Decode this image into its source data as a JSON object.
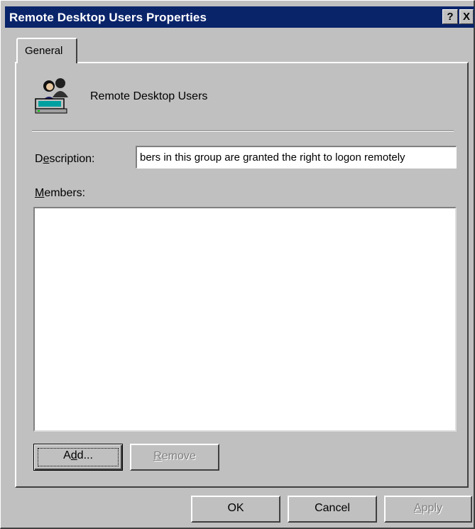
{
  "window": {
    "title": "Remote Desktop Users Properties",
    "help_glyph": "?",
    "close_glyph": "X"
  },
  "tabs": [
    {
      "label": "General"
    }
  ],
  "group": {
    "icon": "users-group-icon",
    "name": "Remote Desktop Users"
  },
  "description": {
    "label_pre": "D",
    "label_ul": "e",
    "label_post": "scription:",
    "value": "bers in this group are granted the right to logon remotely"
  },
  "members": {
    "label_pre": "",
    "label_ul": "M",
    "label_post": "embers:",
    "items": []
  },
  "buttons": {
    "add_pre": "A",
    "add_ul": "d",
    "add_post": "d...",
    "remove_pre": "",
    "remove_ul": "R",
    "remove_post": "emove",
    "ok": "OK",
    "cancel": "Cancel",
    "apply_pre": "",
    "apply_ul": "A",
    "apply_post": "pply"
  },
  "colors": {
    "titlebar": "#0a246a",
    "face": "#c0c0c0",
    "disabled_text": "#808080"
  }
}
